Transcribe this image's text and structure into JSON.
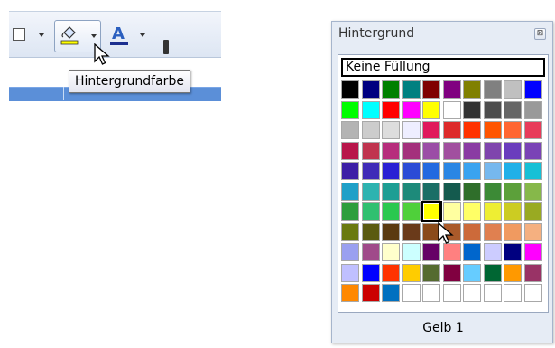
{
  "toolbar": {
    "tooltip": "Hintergrundfarbe",
    "icons": [
      "border-icon",
      "background-color-icon",
      "font-color-icon"
    ]
  },
  "palette": {
    "title": "Hintergrund",
    "close_symbol": "⊠",
    "no_fill_label": "Keine Füllung",
    "selected_name": "Gelb 1",
    "selected_index": 64,
    "swatches": [
      "#000000",
      "#000080",
      "#008000",
      "#008080",
      "#800000",
      "#800080",
      "#808000",
      "#808080",
      "#c0c0c0",
      "#0000ff",
      "#00ff00",
      "#00ffff",
      "#ff0000",
      "#ff00ff",
      "#ffff00",
      "#ffffff",
      "#333333",
      "#4d4d4d",
      "#666666",
      "#999999",
      "#b3b3b3",
      "#cccccc",
      "#dddddd",
      "#eeeeff",
      "#e0195b",
      "#dd2a2a",
      "#ff3300",
      "#ff5500",
      "#ff6633",
      "#e83b5a",
      "#b8154a",
      "#c0344f",
      "#b72d7c",
      "#a4307c",
      "#9b4da6",
      "#a14f9f",
      "#8a3ca3",
      "#7f45ad",
      "#6a3dbd",
      "#7a43b6",
      "#3d1fa6",
      "#3f2bb8",
      "#2a20d4",
      "#2b4bd6",
      "#2269e0",
      "#2a86e4",
      "#3aa3f0",
      "#76b8ee",
      "#20b0e8",
      "#16c0d6",
      "#1fa0c8",
      "#2db3b0",
      "#1d9e94",
      "#1d8a7a",
      "#1a6e66",
      "#145a4e",
      "#2f6e2a",
      "#3c8a36",
      "#5ca03a",
      "#86b84a",
      "#2e9e3c",
      "#2fc070",
      "#2ac84f",
      "#4fd03a",
      "#ffff00",
      "#ffffa0",
      "#ffff66",
      "#eeee33",
      "#cccc22",
      "#99aa22",
      "#6a7a10",
      "#5a5a10",
      "#5a3a10",
      "#6a3a1a",
      "#8a4a1a",
      "#aa5a2a",
      "#cc6a3a",
      "#e08050",
      "#f09a60",
      "#f5b080",
      "#9aa0f0",
      "#a04a8a",
      "#ffffcc",
      "#ccffff",
      "#660066",
      "#ff8080",
      "#0066cc",
      "#ccccff",
      "#000080",
      "#ff00ff",
      "#c0c0ff",
      "#0000ff",
      "#ff3300",
      "#ffcc00",
      "#556b2f",
      "#800040",
      "#66ccff",
      "#006633",
      "#ff9900",
      "#993366",
      "#ff8800",
      "#cc0000",
      "#0070c0",
      "#ffffff",
      "#ffffff",
      "#ffffff",
      "#ffffff",
      "#ffffff",
      "#ffffff",
      "#ffffff"
    ]
  }
}
